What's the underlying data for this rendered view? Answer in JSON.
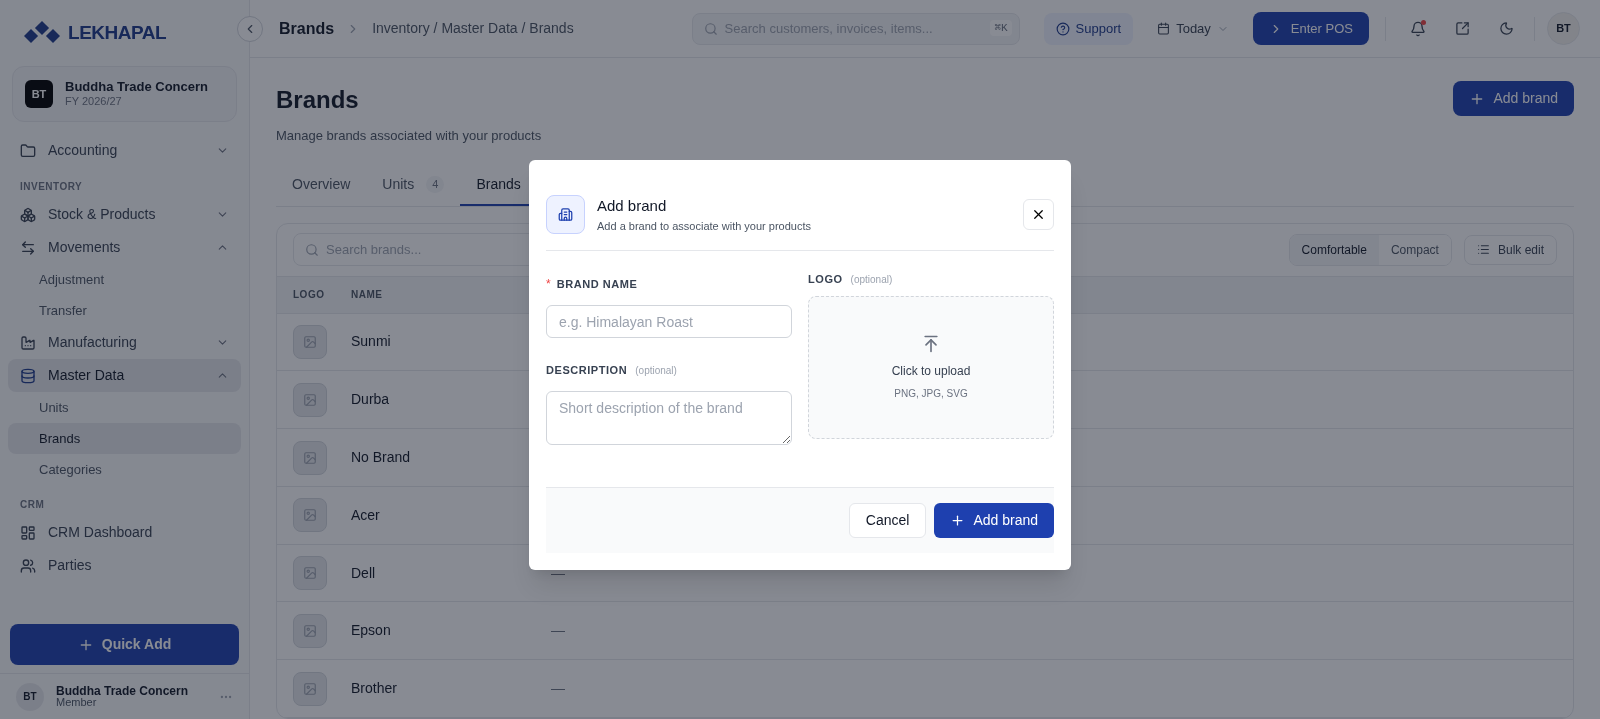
{
  "brand": {
    "name": "LEKHAPAL"
  },
  "org": {
    "initials": "BT",
    "name": "Buddha Trade Concern",
    "period": "FY 2026/27"
  },
  "sidebar": {
    "sections": [
      {
        "items": [
          {
            "label": "Accounting",
            "expanded": false,
            "selected": false
          }
        ]
      },
      {
        "heading": "INVENTORY",
        "items": [
          {
            "label": "Stock & Products",
            "expanded": false,
            "selected": false
          },
          {
            "label": "Movements",
            "expanded": true,
            "selected": false,
            "children": [
              {
                "label": "Adjustment",
                "selected": false
              },
              {
                "label": "Transfer",
                "selected": false
              }
            ]
          },
          {
            "label": "Manufacturing",
            "expanded": false,
            "selected": false
          },
          {
            "label": "Master Data",
            "expanded": true,
            "selected": true,
            "children": [
              {
                "label": "Units",
                "selected": false
              },
              {
                "label": "Brands",
                "selected": true
              },
              {
                "label": "Categories",
                "selected": false
              }
            ]
          }
        ]
      },
      {
        "heading": "CRM",
        "items": [
          {
            "label": "CRM Dashboard",
            "selected": false
          },
          {
            "label": "Parties",
            "selected": false
          }
        ]
      }
    ],
    "quick_add": "Quick Add",
    "user": {
      "initials": "BT",
      "name": "Buddha Trade Concern",
      "role": "Member"
    }
  },
  "topbar": {
    "title": "Brands",
    "breadcrumb": "Inventory / Master Data / Brands",
    "search_placeholder": "Search customers, invoices, items...",
    "shortcut": "⌘K",
    "support": "Support",
    "date": "Today",
    "pos": "Enter POS",
    "notification_dot": true,
    "avatar": "BT"
  },
  "page": {
    "title": "Brands",
    "subtitle": "Manage brands associated with your products",
    "action": "Add brand",
    "tabs": [
      {
        "label": "Overview",
        "selected": false
      },
      {
        "label": "Units",
        "count": "4",
        "selected": false
      },
      {
        "label": "Brands",
        "selected": true
      }
    ]
  },
  "table": {
    "search_placeholder": "Search brands...",
    "density": [
      {
        "label": "Comfortable",
        "selected": true
      },
      {
        "label": "Compact",
        "selected": false
      }
    ],
    "bulk_edit": "Bulk edit",
    "columns": [
      "LOGO",
      "NAME"
    ],
    "rows": [
      {
        "name": "Sunmi"
      },
      {
        "name": "Durba"
      },
      {
        "name": "No Brand"
      },
      {
        "name": "Acer"
      },
      {
        "name": "Dell",
        "column_3": "—"
      },
      {
        "name": "Epson",
        "column_3": "—"
      },
      {
        "name": "Brother",
        "column_3": "—"
      }
    ]
  },
  "dialog": {
    "title": "Add brand",
    "subtitle": "Add a brand to associate with your products",
    "name_label": "BRAND NAME",
    "required_mark": "*",
    "name_placeholder": "e.g. Himalayan Roast",
    "description_label": "DESCRIPTION",
    "description_note": "(optional)",
    "description_placeholder": "Short description of the brand",
    "logo_label": "LOGO",
    "logo_note": "(optional)",
    "upload_title": "Click to upload",
    "upload_formats": "PNG, JPG, SVG",
    "cancel": "Cancel",
    "submit": "Add brand"
  }
}
